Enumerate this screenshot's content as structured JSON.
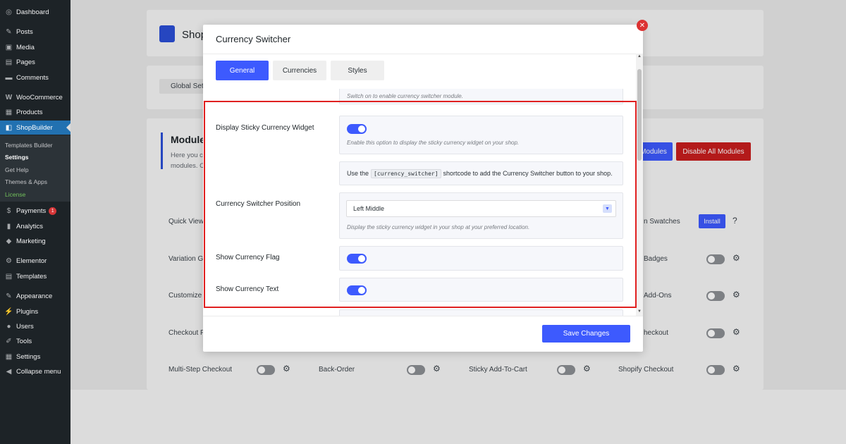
{
  "sidebar": {
    "items": [
      {
        "label": "Dashboard",
        "icon": "dashboard-icon",
        "glyph": "◎"
      },
      {
        "label": "Posts",
        "icon": "pin-icon",
        "glyph": "✎"
      },
      {
        "label": "Media",
        "icon": "media-icon",
        "glyph": "▣"
      },
      {
        "label": "Pages",
        "icon": "pages-icon",
        "glyph": "▤"
      },
      {
        "label": "Comments",
        "icon": "comments-icon",
        "glyph": "▬"
      },
      {
        "label": "WooCommerce",
        "icon": "woocommerce-icon",
        "glyph": "W"
      },
      {
        "label": "Products",
        "icon": "products-icon",
        "glyph": "▦"
      },
      {
        "label": "ShopBuilder",
        "icon": "shopbuilder-icon",
        "glyph": "◧"
      },
      {
        "label": "Payments",
        "icon": "payments-icon",
        "glyph": "$",
        "badge": "1"
      },
      {
        "label": "Analytics",
        "icon": "analytics-icon",
        "glyph": "▮"
      },
      {
        "label": "Marketing",
        "icon": "marketing-icon",
        "glyph": "◆"
      },
      {
        "label": "Elementor",
        "icon": "elementor-icon",
        "glyph": "⚙"
      },
      {
        "label": "Templates",
        "icon": "templates-icon",
        "glyph": "▤"
      },
      {
        "label": "Appearance",
        "icon": "appearance-icon",
        "glyph": "✎"
      },
      {
        "label": "Plugins",
        "icon": "plugins-icon",
        "glyph": "⚡"
      },
      {
        "label": "Users",
        "icon": "users-icon",
        "glyph": "●"
      },
      {
        "label": "Tools",
        "icon": "tools-icon",
        "glyph": "✐"
      },
      {
        "label": "Settings",
        "icon": "settings-icon",
        "glyph": "▦"
      },
      {
        "label": "Collapse menu",
        "icon": "collapse-icon",
        "glyph": "◀"
      }
    ],
    "submenu": [
      "Templates Builder",
      "Settings",
      "Get Help",
      "Themes & Apps",
      "License"
    ]
  },
  "background": {
    "header_title": "Shop",
    "global_tab": "Global Set",
    "modules_title": "Module",
    "modules_desc_1": "Here you c",
    "modules_desc_2": "modules. C",
    "enable_all_btn": "Modules",
    "disable_all_btn": "Disable All Modules",
    "row_labels": [
      "Quick View",
      "Variation G",
      "Customize",
      "Checkout F",
      "Multi-Step Checkout",
      "Back-Order",
      "Sticky Add-To-Cart",
      "Shopify Checkout"
    ],
    "right_labels": [
      "n Swatches",
      "Badges",
      "Add-Ons",
      "heckout"
    ],
    "install_label": "Install"
  },
  "modal": {
    "title": "Currency Switcher",
    "close_glyph": "✕",
    "tabs": [
      "General",
      "Currencies",
      "Styles"
    ],
    "top_desc": "Switch on to enable currency switcher module.",
    "sticky_label": "Display Sticky Currency Widget",
    "sticky_desc": "Enable this option to display the sticky currency widget on your shop.",
    "shortcode_pre": "Use the",
    "shortcode": "[currency_switcher]",
    "shortcode_post": "shortcode to add the Currency Switcher button to your shop.",
    "position_label": "Currency Switcher Position",
    "position_value": "Left Middle",
    "position_desc": "Display the sticky currency widget in your shop at your preferred location.",
    "flag_label": "Show Currency Flag",
    "text_label": "Show Currency Text",
    "save_label": "Save Changes"
  },
  "colors": {
    "accent": "#3d5afe",
    "danger": "#dc3232",
    "highlight": "#e02020"
  }
}
